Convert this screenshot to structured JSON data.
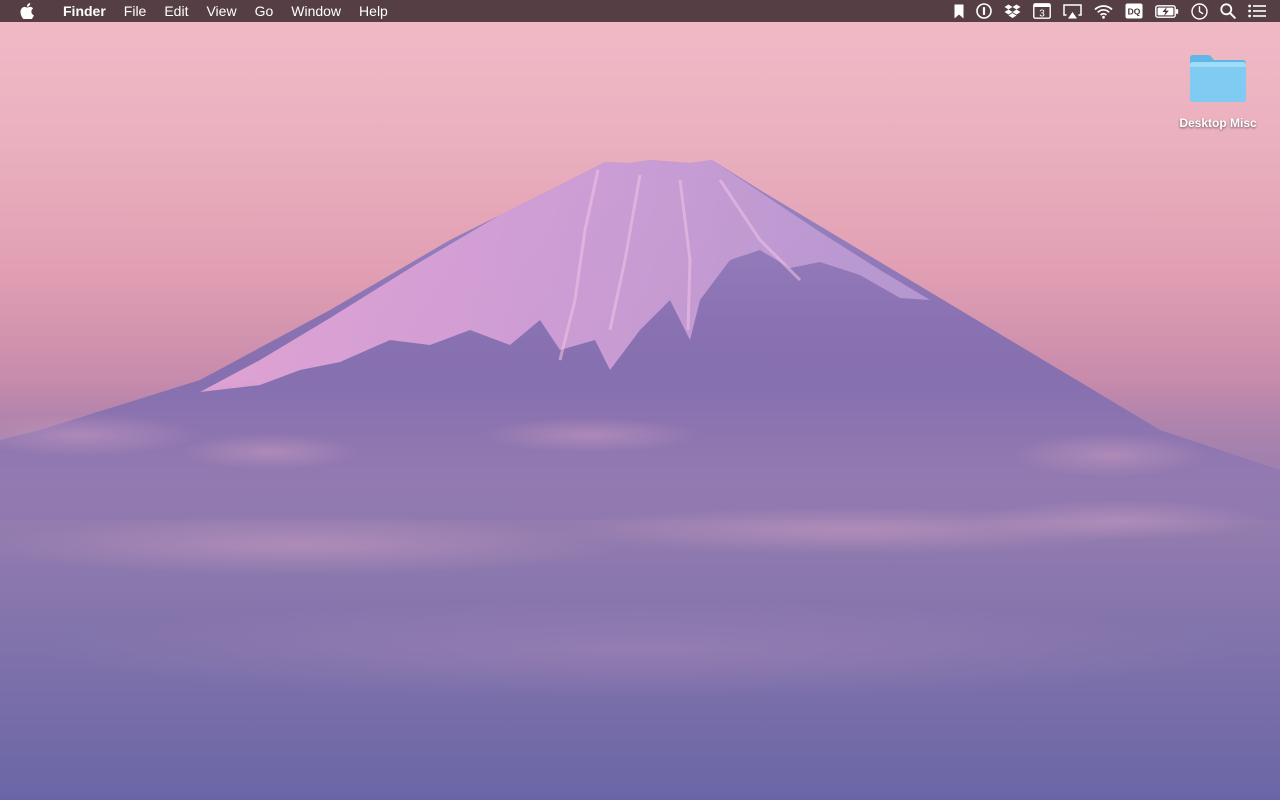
{
  "menubar": {
    "apple_icon": "apple-logo-icon",
    "app_name": "Finder",
    "items": [
      {
        "label": "File"
      },
      {
        "label": "Edit"
      },
      {
        "label": "View"
      },
      {
        "label": "Go"
      },
      {
        "label": "Window"
      },
      {
        "label": "Help"
      }
    ],
    "status_icons": [
      "bookmark-icon",
      "1password-icon",
      "dropbox-icon",
      "calendar-icon",
      "airplay-icon",
      "wifi-icon",
      "dq-icon",
      "battery-charging-icon",
      "clock-icon",
      "spotlight-search-icon",
      "notification-center-icon"
    ],
    "calendar_day": "3",
    "dq_label": "DQ"
  },
  "desktop": {
    "folder": {
      "label": "Desktop Misc",
      "icon": "folder-icon",
      "color": "#7fcbf2"
    }
  },
  "colors": {
    "menubar_bg": "#48343a",
    "sky_top": "#f2bac7",
    "clouds_bottom": "#6261a5"
  }
}
